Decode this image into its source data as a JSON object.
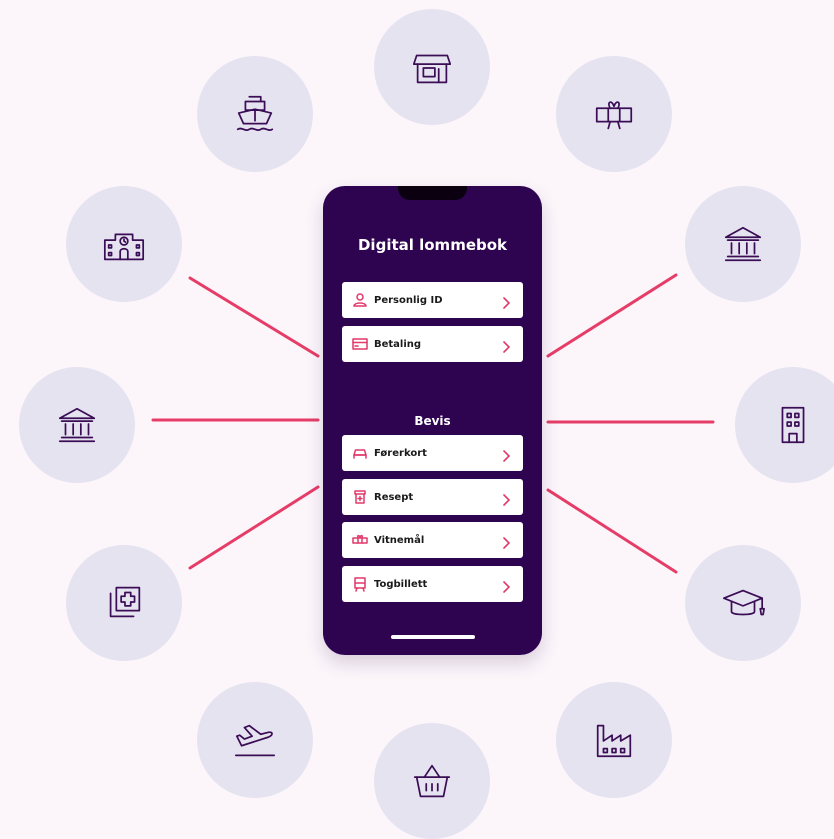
{
  "colors": {
    "line": "#e63d68",
    "circle": "#e6e3f1",
    "phone": "#2e0451",
    "icon_stroke": "#3a0d55",
    "item_icon": "#e0396a"
  },
  "phone": {
    "title": "Digital lommebok",
    "top_items": [
      {
        "label": "Personlig ID",
        "icon": "person-icon"
      },
      {
        "label": "Betaling",
        "icon": "card-icon"
      }
    ],
    "section_title": "Bevis",
    "bevis_items": [
      {
        "label": "Førerkort",
        "icon": "car-icon"
      },
      {
        "label": "Resept",
        "icon": "prescription-icon"
      },
      {
        "label": "Vitnemål",
        "icon": "diploma-icon"
      },
      {
        "label": "Togbillett",
        "icon": "train-icon"
      }
    ]
  },
  "surrounding_icons": [
    "shop-icon",
    "diploma-icon",
    "bank-icon",
    "office-building-icon",
    "graduation-cap-icon",
    "factory-icon",
    "shopping-basket-icon",
    "airplane-icon",
    "medical-copy-icon",
    "bank-icon",
    "school-building-icon",
    "ship-icon"
  ]
}
